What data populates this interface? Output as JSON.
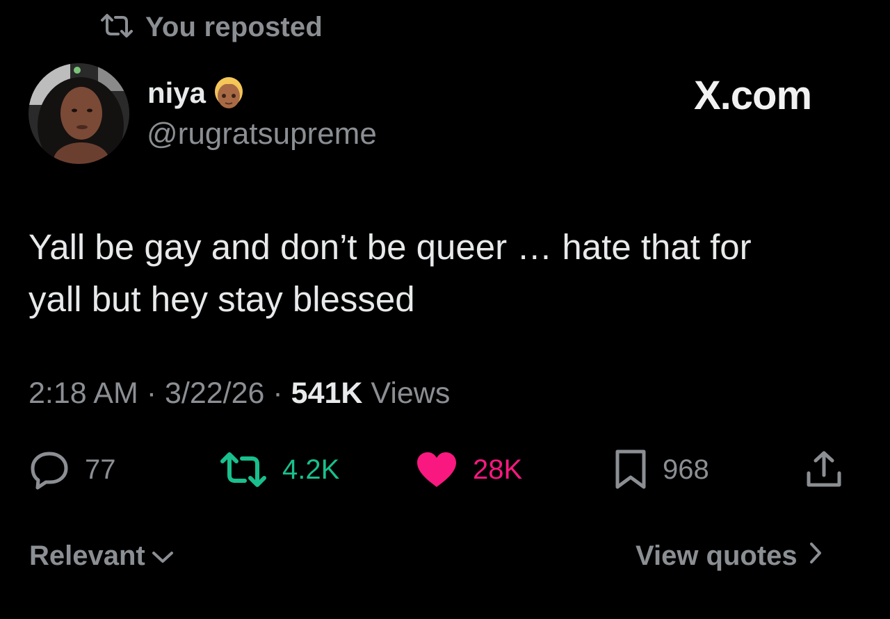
{
  "repost_header": {
    "text": "You reposted",
    "icon": "repost-icon"
  },
  "author": {
    "display_name": "niya",
    "badge_emoji": "blond-person-emoji",
    "handle": "@rugratsupreme",
    "avatar": "profile-photo"
  },
  "brand": {
    "text": "X.com"
  },
  "tweet": {
    "line1": "Yall be gay and don’t be queer … hate that for",
    "line2": "yall but hey stay blessed"
  },
  "meta": {
    "time": "2:18 AM",
    "sep1": " · ",
    "date": "3/22/26",
    "sep2": " · ",
    "views_count": "541K",
    "views_label": " Views"
  },
  "actions": {
    "reply": {
      "count": "77",
      "icon": "reply-icon",
      "color": "#8b8f93"
    },
    "repost": {
      "count": "4.2K",
      "icon": "repost-icon",
      "color": "#19bf8c"
    },
    "like": {
      "count": "28K",
      "icon": "heart-icon",
      "color": "#f91880"
    },
    "bookmark": {
      "count": "968",
      "icon": "bookmark-icon",
      "color": "#8b8f93"
    },
    "share": {
      "icon": "share-icon"
    }
  },
  "footer": {
    "sort_label": "Relevant",
    "sort_icon": "chevron-down-icon",
    "quotes_label": "View quotes",
    "quotes_icon": "chevron-right-icon"
  },
  "colors": {
    "background": "#000000",
    "text": "#e7e9ea",
    "muted": "#8b8f93"
  }
}
